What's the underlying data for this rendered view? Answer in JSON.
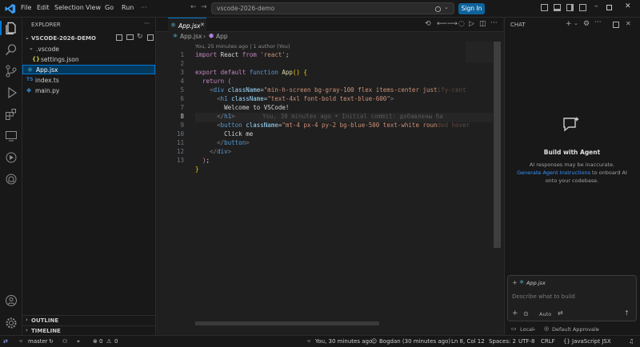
{
  "menu": [
    "File",
    "Edit",
    "Selection",
    "View",
    "Go",
    "Run"
  ],
  "search": {
    "value": "vscode-2026-demo"
  },
  "signin_label": "Sign In",
  "explorer": {
    "title": "EXPLORER",
    "root": "VSCODE-2026-DEMO",
    "items": [
      {
        "label": ".vscode",
        "icon": "chevron-down-icon"
      },
      {
        "label": "settings.json",
        "icon": "json-icon"
      },
      {
        "label": "App.jsx",
        "icon": "react-icon"
      },
      {
        "label": "index.ts",
        "icon": "ts-icon"
      },
      {
        "label": "main.py",
        "icon": "python-icon"
      }
    ],
    "outline": "OUTLINE",
    "timeline": "TIMELINE"
  },
  "tab": {
    "label": "App.jsx"
  },
  "breadcrumb": {
    "file": "App.jsx",
    "symbol": "App"
  },
  "codelens": "You, 25 minutes ago | 1 author (You)",
  "blame_inline": "You, 30 minutes ago • Initial commit: добавлены ба",
  "line_numbers": [
    "1",
    "2",
    "3",
    "4",
    "5",
    "6",
    "7",
    "8",
    "9",
    "10",
    "11",
    "12",
    "13"
  ],
  "chat": {
    "title": "CHAT",
    "heading": "Build with Agent",
    "line1": "AI responses may be inaccurate.",
    "link": "Generate Agent Instructions",
    "line2_rest": " to onboard AI",
    "line3": "onto your codebase.",
    "context_file": "App.jsx",
    "input_placeholder": "Describe what to build",
    "mode": "Auto",
    "local": "Local",
    "approvals": "Default Approvals"
  },
  "status": {
    "branch": "master",
    "errors": "0",
    "warnings": "0",
    "blame": "You, 30 minutes ago",
    "author": "Bogdan (30 minutes ago)",
    "position": "Ln 8, Col 12",
    "spaces": "Spaces: 2",
    "encoding": "UTF-8",
    "eol": "CRLF",
    "language": "JavaScript JSX"
  }
}
